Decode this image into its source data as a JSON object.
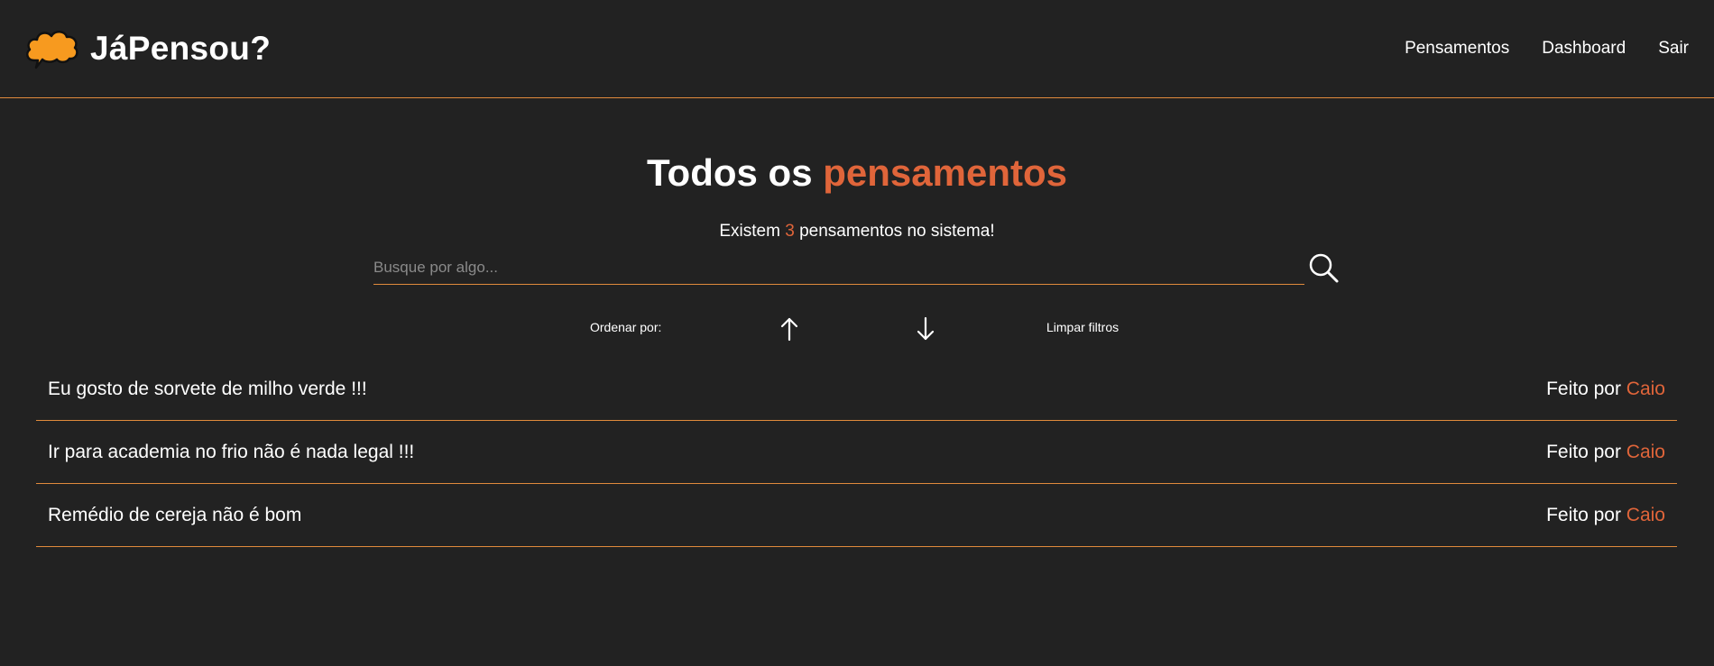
{
  "header": {
    "brand_name": "JáPensou?",
    "logo_icon": "cloud-speech-bubble-icon",
    "nav": [
      {
        "label": "Pensamentos"
      },
      {
        "label": "Dashboard"
      },
      {
        "label": "Sair"
      }
    ]
  },
  "main": {
    "title_prefix": "Todos os",
    "title_accent": "pensamentos",
    "count_prefix": "Existem",
    "count": "3",
    "count_suffix": "pensamentos no sistema!",
    "search": {
      "placeholder": "Busque por algo...",
      "value": "",
      "icon": "search-icon"
    },
    "sort": {
      "label": "Ordenar por:",
      "asc_icon": "arrow-up-icon",
      "desc_icon": "arrow-down-icon",
      "clear_label": "Limpar filtros"
    },
    "thoughts": [
      {
        "text": "Eu gosto de sorvete de milho verde !!!",
        "author_prefix": "Feito por",
        "author": "Caio"
      },
      {
        "text": "Ir para academia no frio não é nada legal !!!",
        "author_prefix": "Feito por",
        "author": "Caio"
      },
      {
        "text": "Remédio de cereja não é bom",
        "author_prefix": "Feito por",
        "author": "Caio"
      }
    ]
  },
  "colors": {
    "background": "#222222",
    "accent": "#e0653a",
    "divider": "#e08a3c",
    "logo": "#f79a1f",
    "text": "#ffffff"
  }
}
